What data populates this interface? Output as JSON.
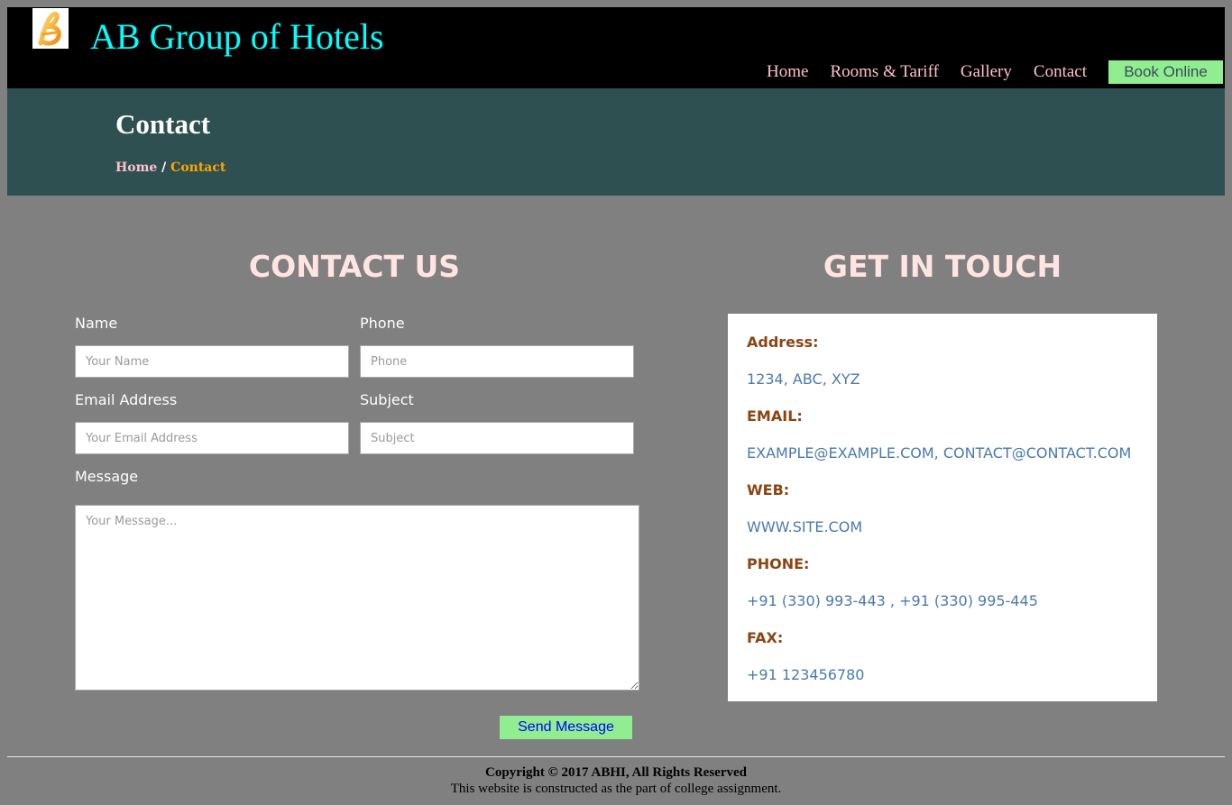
{
  "header": {
    "site_title": "AB Group of Hotels",
    "nav": [
      {
        "label": "Home"
      },
      {
        "label": "Rooms & Tariff"
      },
      {
        "label": "Gallery"
      },
      {
        "label": "Contact"
      }
    ],
    "book_label": "Book Online"
  },
  "banner": {
    "title": "Contact",
    "breadcrumb": {
      "home": "Home",
      "separator": "/",
      "current": "Contact"
    }
  },
  "contact_form": {
    "heading": "CONTACT US",
    "name_label": "Name",
    "name_placeholder": "Your Name",
    "phone_label": "Phone",
    "phone_placeholder": "Phone",
    "email_label": "Email Address",
    "email_placeholder": "Your Email Address",
    "subject_label": "Subject",
    "subject_placeholder": "Subject",
    "message_label": "Message",
    "message_placeholder": "Your Message...",
    "send_label": "Send Message"
  },
  "get_in_touch": {
    "heading": "GET IN TOUCH",
    "address_label": "Address:",
    "address_value": "1234, ABC, XYZ",
    "email_label": "EMAIL:",
    "email_value": "EXAMPLE@EXAMPLE.COM, CONTACT@CONTACT.COM",
    "web_label": "WEB:",
    "web_value": "WWW.SITE.COM",
    "phone_label": "PHONE:",
    "phone_value": "+91 (330) 993-443 , +91 (330) 995-445",
    "fax_label": "FAX:",
    "fax_value": "+91 123456780"
  },
  "footer": {
    "copyright": "Copyright © 2017 ABHI, All Rights Reserved",
    "note": "This website is constructed as the part of college assignment."
  },
  "colors": {
    "page_bg": "#808080",
    "header_bg": "#000000",
    "banner_bg": "#2f5050",
    "title": "#00ffff",
    "nav_link": "#ffc0cb",
    "accent_button": "#90ee90",
    "heading": "#ffe4e1",
    "info_label": "#8b4513",
    "info_value": "#4a7aad"
  },
  "icons": {
    "logo": "ab-logo-icon"
  }
}
